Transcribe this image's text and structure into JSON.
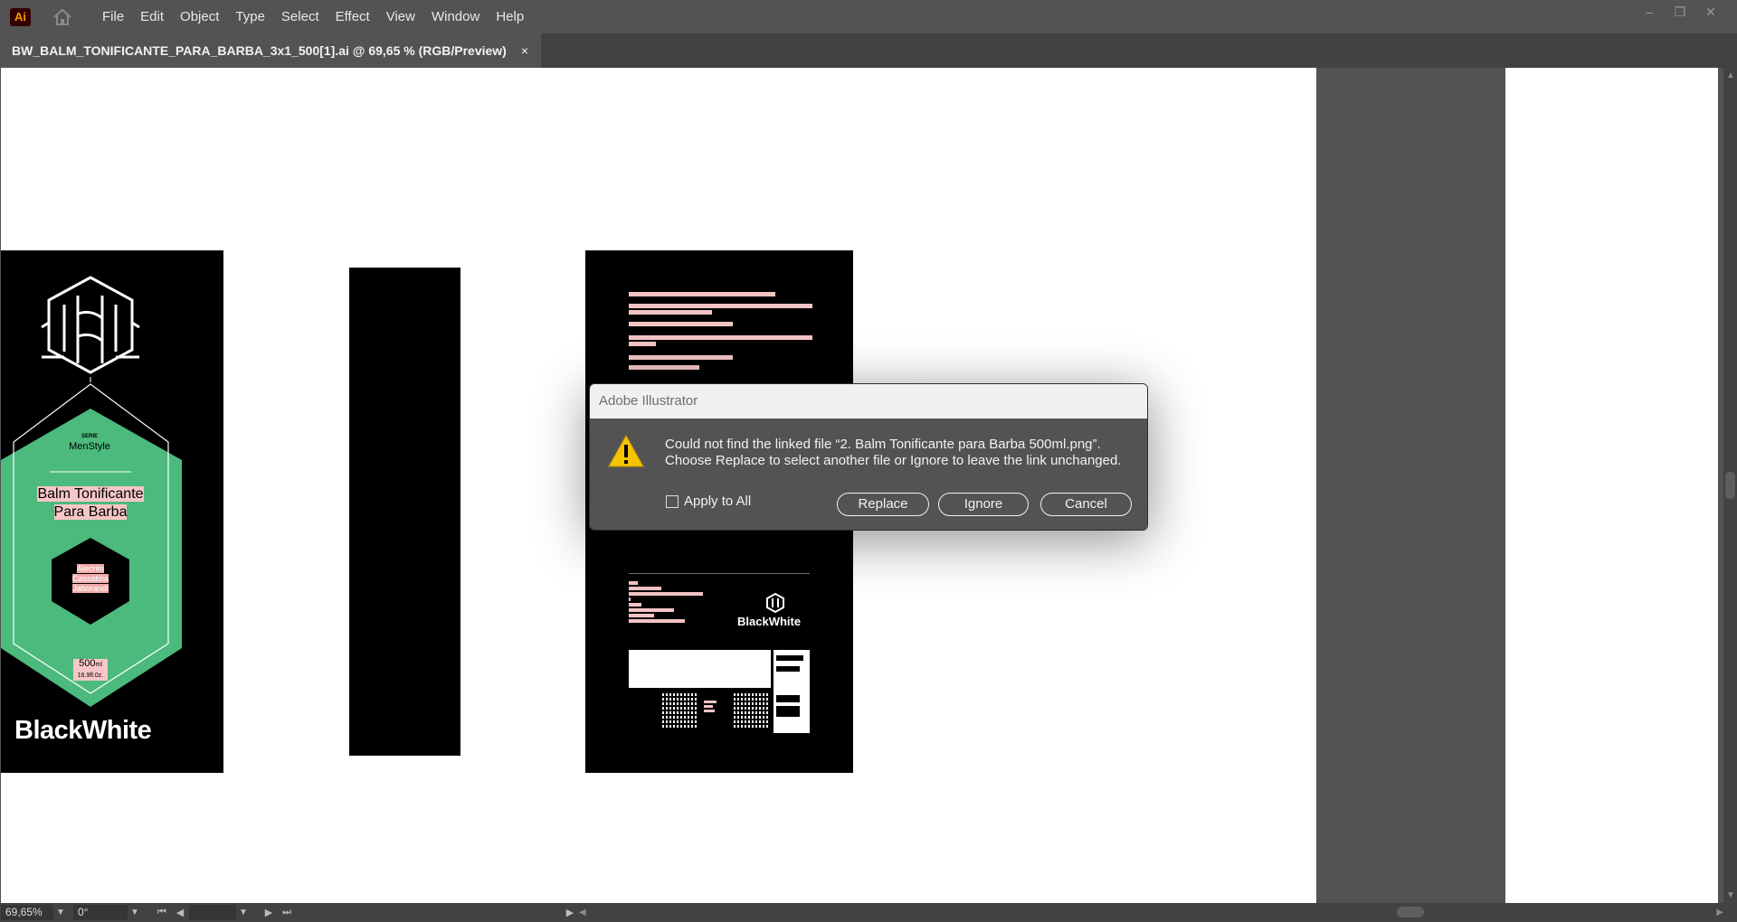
{
  "app": {
    "logo_text": "Ai",
    "brand_color": "#ff9a00"
  },
  "menu": {
    "items": [
      "File",
      "Edit",
      "Object",
      "Type",
      "Select",
      "Effect",
      "View",
      "Window",
      "Help"
    ]
  },
  "window_controls": {
    "minimize": "–",
    "restore": "❐",
    "close": "✕"
  },
  "document_tab": {
    "title": "BW_BALM_TONIFICANTE_PARA_BARBA_3x1_500[1].ai @ 69,65 % (RGB/Preview)",
    "close": "×"
  },
  "artwork": {
    "serie": "SERIE",
    "line": "MenStyle",
    "product_line1": "Balm Tonificante",
    "product_line2": "Para Barba",
    "ingredients": [
      "Alecrim",
      "Cassatina",
      "Jaborandi"
    ],
    "volume": "500",
    "volume_unit": "ml",
    "volume_oz": "16.9fl.0z.",
    "brand": "BlackWhite",
    "accent_color": "#4cba7d"
  },
  "dialog": {
    "title": "Adobe Illustrator",
    "message_line1": "Could not find the linked file “2. Balm Tonificante para Barba 500ml.png”.",
    "message_line2": "Choose Replace to select another file or Ignore to leave the link unchanged.",
    "checkbox_label": "Apply to All",
    "checkbox_checked": false,
    "replace_label": "Replace",
    "ignore_label": "Ignore",
    "cancel_label": "Cancel"
  },
  "statusbar": {
    "zoom": "69,65%",
    "rotation": "0°"
  }
}
